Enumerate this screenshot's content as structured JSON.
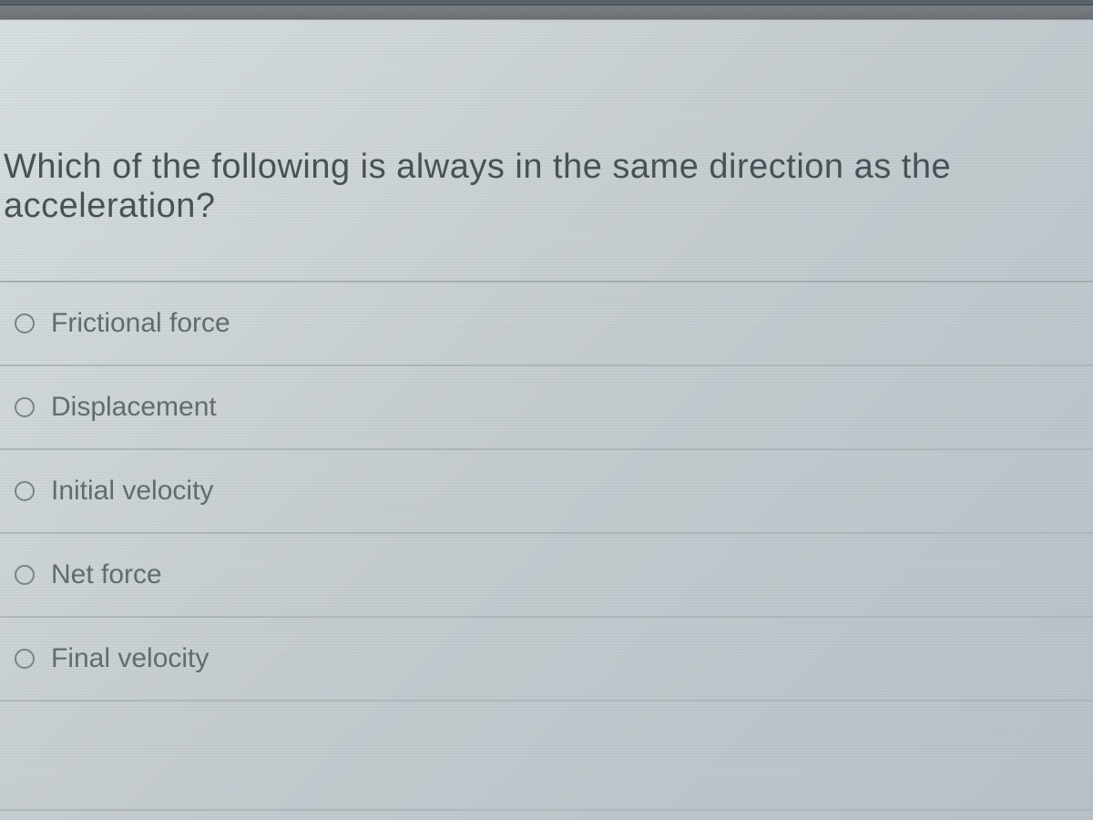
{
  "question": {
    "text": "Which of the following is always in the same direction as the acceleration?"
  },
  "options": [
    {
      "label": "Frictional force"
    },
    {
      "label": "Displacement"
    },
    {
      "label": "Initial velocity"
    },
    {
      "label": "Net force"
    },
    {
      "label": "Final velocity"
    }
  ]
}
